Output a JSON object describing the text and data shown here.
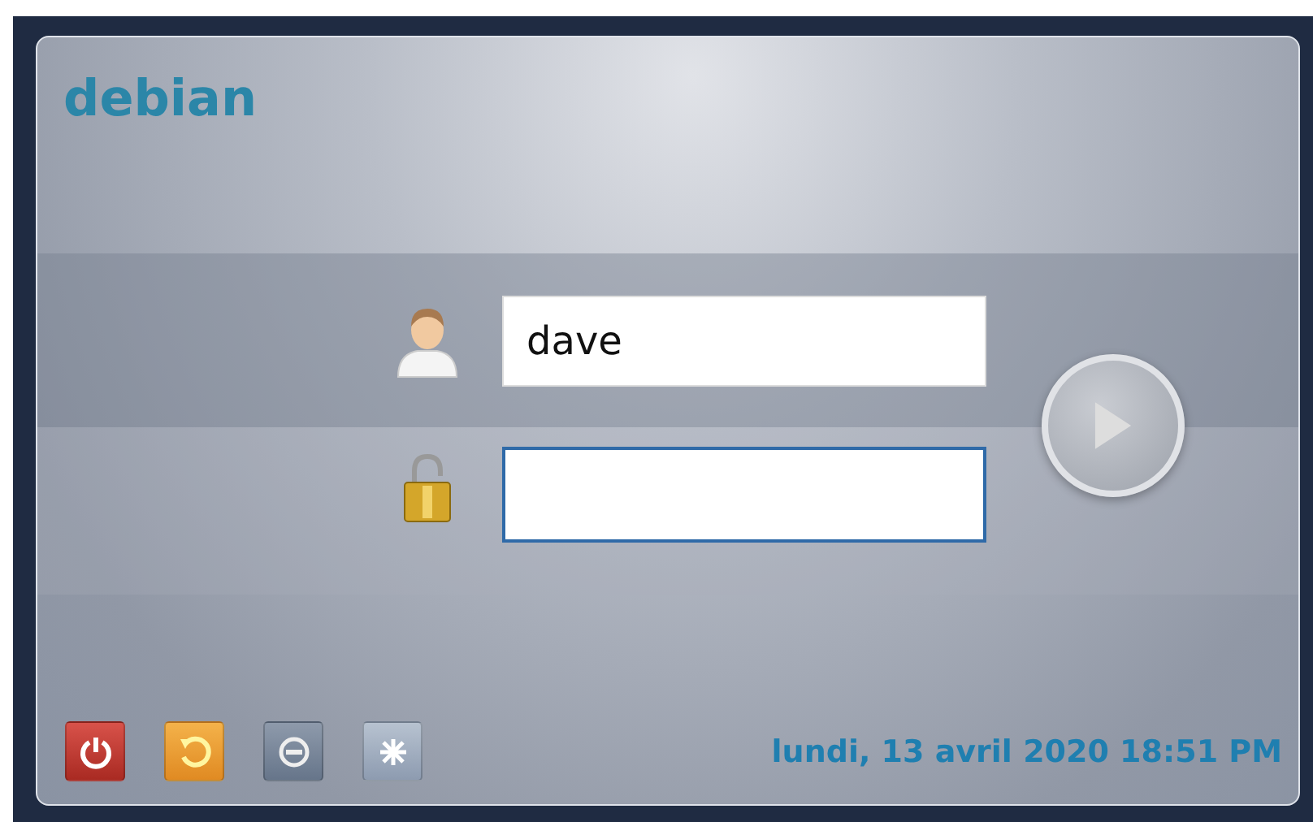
{
  "title": "debian",
  "fields": [
    {
      "kind": "user",
      "value": "dave",
      "focused": false
    },
    {
      "kind": "password",
      "focused": true
    }
  ],
  "footer_buttons": [
    {
      "kind": "power"
    },
    {
      "kind": "restart"
    },
    {
      "kind": "suspend"
    },
    {
      "kind": "hibernate"
    }
  ],
  "datetime": "lundi, 13 avril 2020 18:51 PM"
}
